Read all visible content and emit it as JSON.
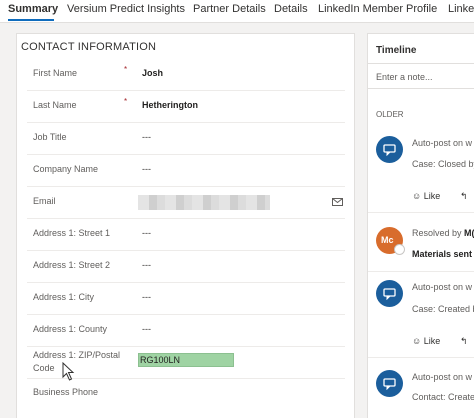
{
  "tabs": [
    {
      "label": "Summary",
      "active": true
    },
    {
      "label": "Versium Predict Insights"
    },
    {
      "label": "Partner Details"
    },
    {
      "label": "Details"
    },
    {
      "label": "LinkedIn Member Profile"
    },
    {
      "label": "Linke"
    }
  ],
  "contact": {
    "section_title": "CONTACT INFORMATION",
    "fields": [
      {
        "label": "First Name",
        "required": "*",
        "value": "Josh"
      },
      {
        "label": "Last Name",
        "required": "*",
        "value": "Hetherington"
      },
      {
        "label": "Job Title",
        "value": "---"
      },
      {
        "label": "Company Name",
        "value": "---"
      },
      {
        "label": "Email"
      },
      {
        "label": "Address 1: Street 1",
        "value": "---"
      },
      {
        "label": "Address 1: Street 2",
        "value": "---"
      },
      {
        "label": "Address 1: City",
        "value": "---"
      },
      {
        "label": "Address 1: County",
        "value": "---"
      },
      {
        "label_line1": "Address 1: ZIP/Postal",
        "label_line2": "Code",
        "value": "RG100LN"
      },
      {
        "label": "Business Phone"
      }
    ]
  },
  "timeline": {
    "title": "Timeline",
    "placeholder": "Enter a note...",
    "older_label": "OLDER",
    "entries": [
      {
        "line1": "Auto-post on w",
        "line2": "Case: Closed by",
        "like": "Like",
        "icon": "post-icon"
      },
      {
        "line1": "Resolved by",
        "sender": "M(",
        "line2": "Materials sent",
        "initials": "Mc"
      },
      {
        "line1": "Auto-post on w",
        "line2": "Case: Created b",
        "like": "Like",
        "icon": "post-icon"
      },
      {
        "line1": "Auto-post on w",
        "line2": "Contact: Create",
        "icon": "post-icon"
      }
    ]
  },
  "colors": {
    "accent": "#0f6cbd",
    "required": "#a4262c",
    "highlight": "#9fd3a3",
    "avatar_blue": "#1b5e9c",
    "avatar_orange": "#d86c2c"
  }
}
